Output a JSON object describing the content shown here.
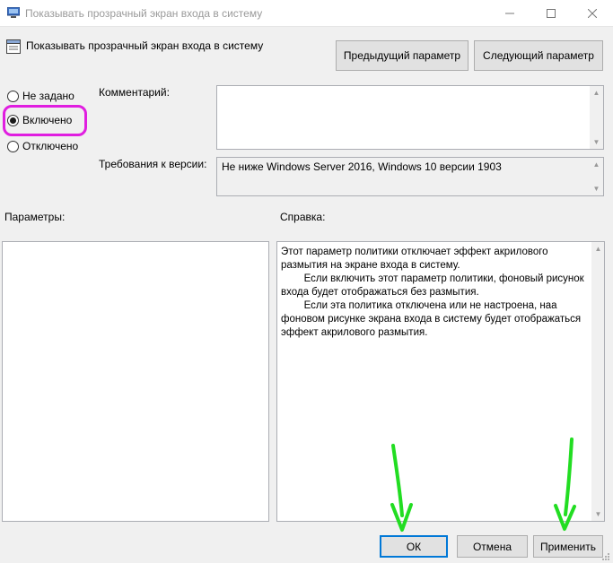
{
  "window": {
    "title": "Показывать прозрачный экран входа в систему",
    "icon": "policy-icon"
  },
  "header": {
    "title": "Показывать прозрачный экран входа в систему",
    "icon": "setting-icon"
  },
  "nav": {
    "prev_label": "Предыдущий параметр",
    "next_label": "Следующий параметр"
  },
  "state": {
    "options": [
      {
        "label": "Не задано",
        "checked": false
      },
      {
        "label": "Включено",
        "checked": true
      },
      {
        "label": "Отключено",
        "checked": false
      }
    ],
    "highlight_color": "#e01ee0"
  },
  "comment": {
    "label": "Комментарий:",
    "value": ""
  },
  "version": {
    "label": "Требования к версии:",
    "value": "Не ниже Windows Server 2016, Windows 10 версии 1903"
  },
  "params": {
    "label": "Параметры:"
  },
  "help": {
    "label": "Справка:",
    "paragraphs": [
      "Этот параметр политики отключает эффект акрилового размытия на экране входа в систему.",
      "",
      "        Если включить этот параметр политики, фоновый рисунок входа будет отображаться без размытия.",
      "        Если эта политика отключена или не настроена, наа фоновом рисунке экрана входа в систему будет отображаться эффект акрилового размытия."
    ]
  },
  "footer": {
    "ok_label": "ОК",
    "cancel_label": "Отмена",
    "apply_label": "Применить"
  },
  "annotations": {
    "arrow_color": "#22dd22"
  }
}
